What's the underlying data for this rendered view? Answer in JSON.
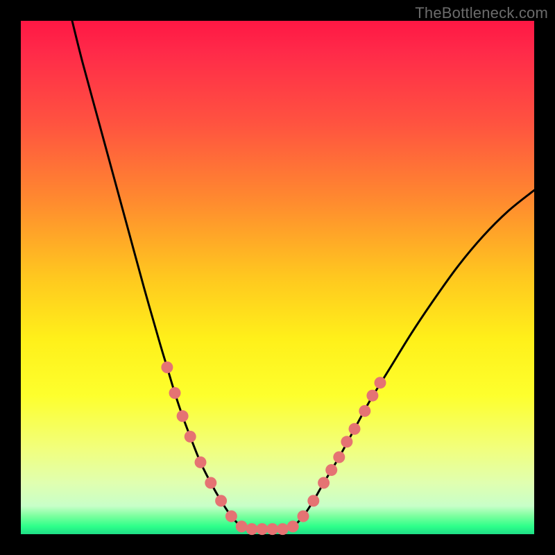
{
  "watermark": "TheBottleneck.com",
  "colors": {
    "black": "#000000",
    "dot": "#E57373",
    "curve": "#000000"
  },
  "gradient_stops": [
    {
      "offset": 0.0,
      "color": "#ff1744"
    },
    {
      "offset": 0.06,
      "color": "#ff2a49"
    },
    {
      "offset": 0.2,
      "color": "#ff5340"
    },
    {
      "offset": 0.35,
      "color": "#ff8a2f"
    },
    {
      "offset": 0.5,
      "color": "#ffc81f"
    },
    {
      "offset": 0.62,
      "color": "#fff01a"
    },
    {
      "offset": 0.73,
      "color": "#fdff2d"
    },
    {
      "offset": 0.83,
      "color": "#f2ff7a"
    },
    {
      "offset": 0.9,
      "color": "#e0ffb0"
    },
    {
      "offset": 0.945,
      "color": "#c8ffc8"
    },
    {
      "offset": 0.965,
      "color": "#7aff9e"
    },
    {
      "offset": 0.985,
      "color": "#2dff8a"
    },
    {
      "offset": 1.0,
      "color": "#1fdd86"
    }
  ],
  "chart_data": {
    "type": "line",
    "title": "",
    "xlabel": "",
    "ylabel": "",
    "xlim": [
      0,
      100
    ],
    "ylim": [
      0,
      100
    ],
    "series": [
      {
        "name": "left-curve",
        "x": [
          10.0,
          12.0,
          15.0,
          18.0,
          21.0,
          24.0,
          27.0,
          28.5,
          30.0,
          31.5,
          33.0,
          35.0,
          37.0,
          39.0,
          41.0,
          43.0
        ],
        "values": [
          100.0,
          92.0,
          81.0,
          70.0,
          59.0,
          48.0,
          37.5,
          32.5,
          27.5,
          23.0,
          19.0,
          14.0,
          10.0,
          6.5,
          3.5,
          1.5
        ]
      },
      {
        "name": "valley-floor",
        "x": [
          43.0,
          45.0,
          47.0,
          49.0,
          51.0,
          53.0
        ],
        "values": [
          1.5,
          1.0,
          1.0,
          1.0,
          1.0,
          1.5
        ]
      },
      {
        "name": "right-curve",
        "x": [
          53.0,
          55.0,
          57.0,
          59.0,
          62.0,
          65.0,
          68.0,
          72.0,
          76.0,
          80.0,
          85.0,
          90.0,
          95.0,
          100.0
        ],
        "values": [
          1.5,
          3.5,
          6.5,
          10.0,
          15.0,
          20.5,
          26.0,
          32.5,
          39.0,
          45.0,
          52.0,
          58.0,
          63.0,
          67.0
        ]
      }
    ],
    "dots": {
      "name": "highlighted-points",
      "points": [
        {
          "x": 28.5,
          "y": 32.5
        },
        {
          "x": 30.0,
          "y": 27.5
        },
        {
          "x": 31.5,
          "y": 23.0
        },
        {
          "x": 33.0,
          "y": 19.0
        },
        {
          "x": 35.0,
          "y": 14.0
        },
        {
          "x": 37.0,
          "y": 10.0
        },
        {
          "x": 39.0,
          "y": 6.5
        },
        {
          "x": 41.0,
          "y": 3.5
        },
        {
          "x": 43.0,
          "y": 1.5
        },
        {
          "x": 45.0,
          "y": 1.0
        },
        {
          "x": 47.0,
          "y": 1.0
        },
        {
          "x": 49.0,
          "y": 1.0
        },
        {
          "x": 51.0,
          "y": 1.0
        },
        {
          "x": 53.0,
          "y": 1.5
        },
        {
          "x": 55.0,
          "y": 3.5
        },
        {
          "x": 57.0,
          "y": 6.5
        },
        {
          "x": 59.0,
          "y": 10.0
        },
        {
          "x": 60.5,
          "y": 12.5
        },
        {
          "x": 62.0,
          "y": 15.0
        },
        {
          "x": 63.5,
          "y": 18.0
        },
        {
          "x": 65.0,
          "y": 20.5
        },
        {
          "x": 67.0,
          "y": 24.0
        },
        {
          "x": 68.5,
          "y": 27.0
        },
        {
          "x": 70.0,
          "y": 29.5
        }
      ]
    }
  }
}
